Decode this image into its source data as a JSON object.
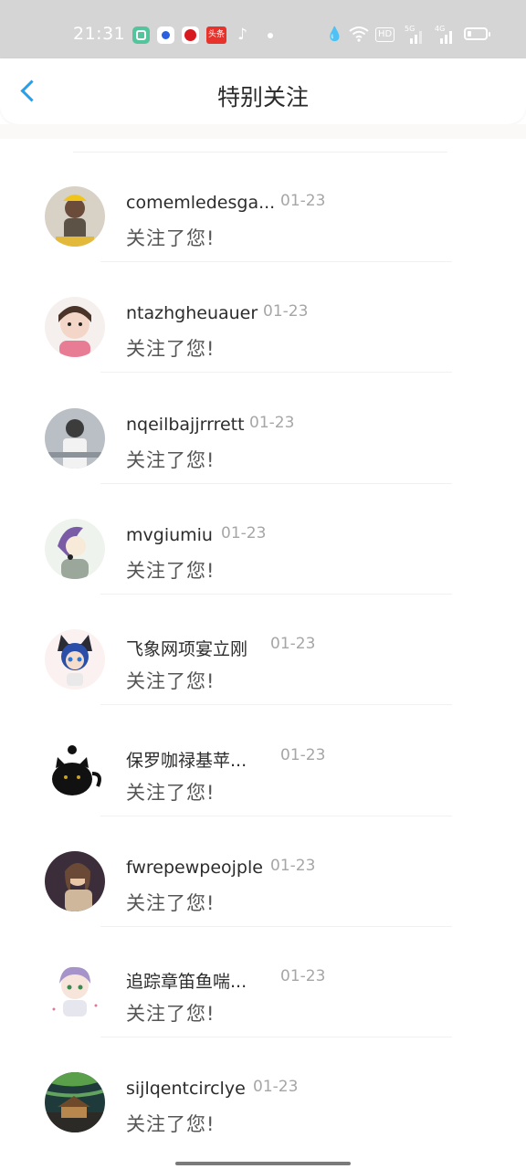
{
  "status_bar": {
    "time": "21:31",
    "app_icons": [
      "chat-app-icon",
      "baidu-icon",
      "video-app-icon",
      "toutiao-icon",
      "tiktok-icon"
    ],
    "toutiao_label": "头条",
    "tiktok_glyph": "♪",
    "hd_label": "HD",
    "signal1_label": "5G",
    "signal2_label": "4G",
    "battery_level": 0.2
  },
  "nav": {
    "back_icon": "chevron-left-icon",
    "title": "特别关注",
    "accent_color": "#2b9fe4"
  },
  "notifications": [
    {
      "username": "comemledesga...",
      "date": "01-23",
      "message": "关注了您!"
    },
    {
      "username": "ntazhgheuauer",
      "date": "01-23",
      "message": "关注了您!"
    },
    {
      "username": "nqeilbajjrrrett",
      "date": "01-23",
      "message": "关注了您!"
    },
    {
      "username": "mvgiumiu",
      "date": "01-23",
      "message": "关注了您!"
    },
    {
      "username": "飞象网项宴立刚",
      "date": "01-23",
      "message": "关注了您!"
    },
    {
      "username": "保罗咖禄基苹...",
      "date": "01-23",
      "message": "关注了您!"
    },
    {
      "username": "fwrepewpeojple",
      "date": "01-23",
      "message": "关注了您!"
    },
    {
      "username": "追踪章笛鱼喘...",
      "date": "01-23",
      "message": "关注了您!"
    },
    {
      "username": "sijlqentcirclye",
      "date": "01-23",
      "message": "关注了您!"
    }
  ]
}
